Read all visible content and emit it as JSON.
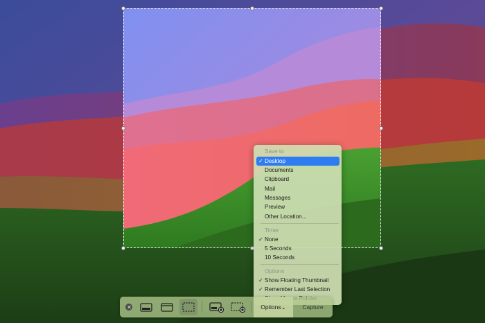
{
  "menu": {
    "save_to_header": "Save to",
    "save_items": [
      "Desktop",
      "Documents",
      "Clipboard",
      "Mail",
      "Messages",
      "Preview",
      "Other Location..."
    ],
    "save_selected": "Desktop",
    "timer_header": "Timer",
    "timer_items": [
      "None",
      "5 Seconds",
      "10 Seconds"
    ],
    "timer_selected": "None",
    "options_header": "Options",
    "option_items": [
      "Show Floating Thumbnail",
      "Remember Last Selection",
      "Show Mouse Pointer"
    ],
    "options_checked": [
      "Show Floating Thumbnail",
      "Remember Last Selection"
    ],
    "check_glyph": "✓"
  },
  "toolbar": {
    "options_label": "Options",
    "options_chevron": "⌄",
    "capture_label": "Capture",
    "tools": [
      {
        "name": "capture-entire-screen-icon",
        "selected": false
      },
      {
        "name": "capture-selected-window-icon",
        "selected": false
      },
      {
        "name": "capture-selected-portion-icon",
        "selected": true
      },
      {
        "name": "record-entire-screen-icon",
        "selected": false
      },
      {
        "name": "record-selected-portion-icon",
        "selected": false
      }
    ]
  },
  "colors": {
    "accent": "#2f7bf0"
  }
}
